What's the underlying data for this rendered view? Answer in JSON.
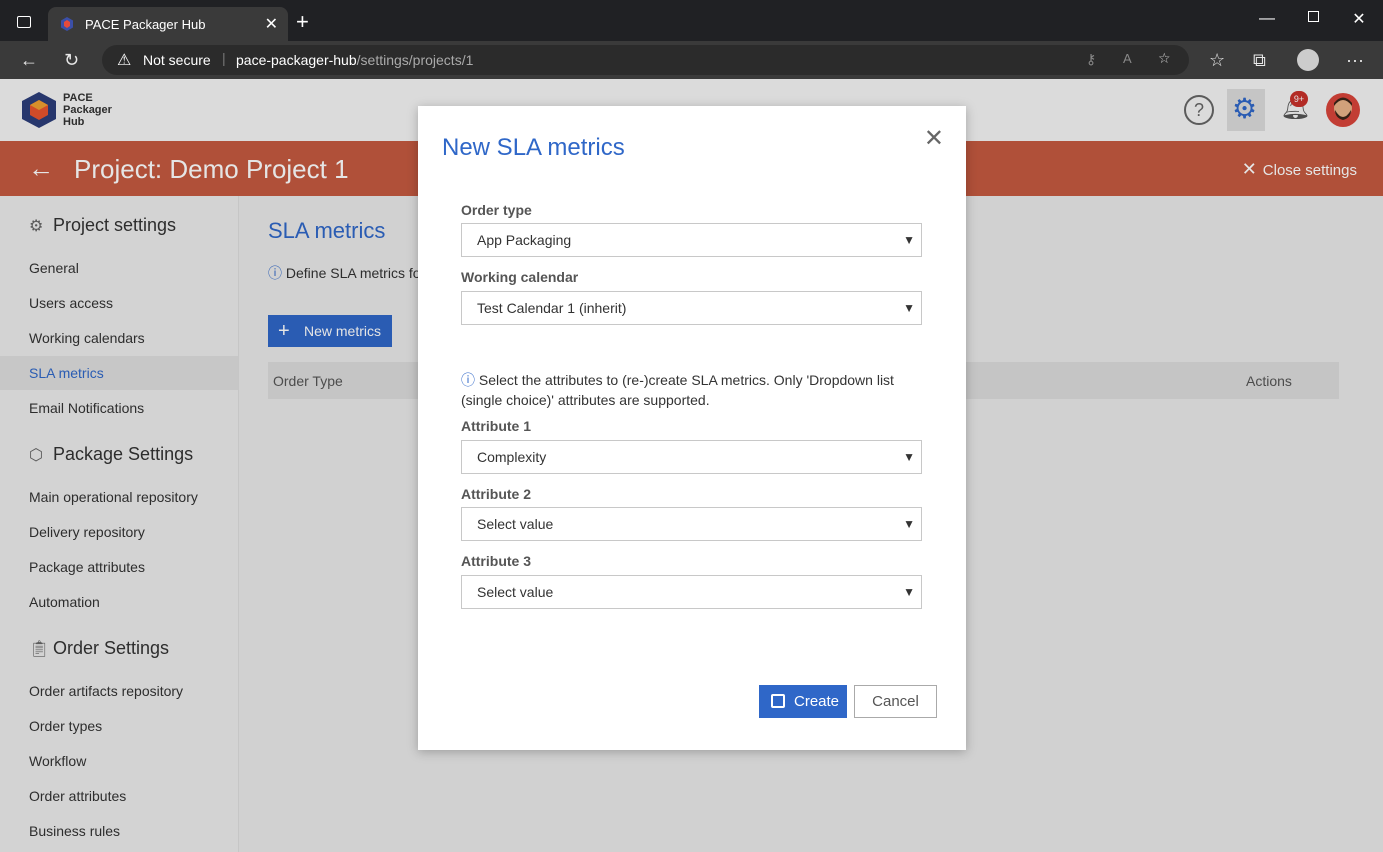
{
  "browser": {
    "tab_title": "PACE Packager Hub",
    "security_label": "Not secure",
    "url_host": "pace-packager-hub",
    "url_path": "/settings/projects/1"
  },
  "app": {
    "logo_line1": "PACE",
    "logo_line2": "Packager",
    "logo_line3": "Hub",
    "notification_badge": "9+"
  },
  "project_bar": {
    "title": "Project: Demo Project 1",
    "close_label": "Close settings"
  },
  "sidebar": {
    "project_settings_title": "Project settings",
    "project_items": [
      "General",
      "Users access",
      "Working calendars",
      "SLA metrics",
      "Email Notifications"
    ],
    "package_settings_title": "Package Settings",
    "package_items": [
      "Main operational repository",
      "Delivery repository",
      "Package attributes",
      "Automation"
    ],
    "order_settings_title": "Order Settings",
    "order_items": [
      "Order artifacts repository",
      "Order types",
      "Workflow",
      "Order attributes",
      "Business rules"
    ]
  },
  "main": {
    "title": "SLA metrics",
    "description": "Define SLA metrics fo",
    "new_button": "New metrics",
    "col_order_type": "Order Type",
    "col_actions": "Actions"
  },
  "modal": {
    "title": "New SLA metrics",
    "order_type_label": "Order type",
    "order_type_value": "App Packaging",
    "calendar_label": "Working calendar",
    "calendar_value": "Test Calendar 1 (inherit)",
    "info_text": "Select the attributes to (re-)create SLA metrics. Only 'Dropdown list (single choice)' attributes are supported.",
    "attr1_label": "Attribute 1",
    "attr1_value": "Complexity",
    "attr2_label": "Attribute 2",
    "attr2_value": "Select value",
    "attr3_label": "Attribute 3",
    "attr3_value": "Select value",
    "create_label": "Create",
    "cancel_label": "Cancel"
  },
  "colors": {
    "accent": "#2f67c8",
    "project_bar": "#c45a40"
  }
}
